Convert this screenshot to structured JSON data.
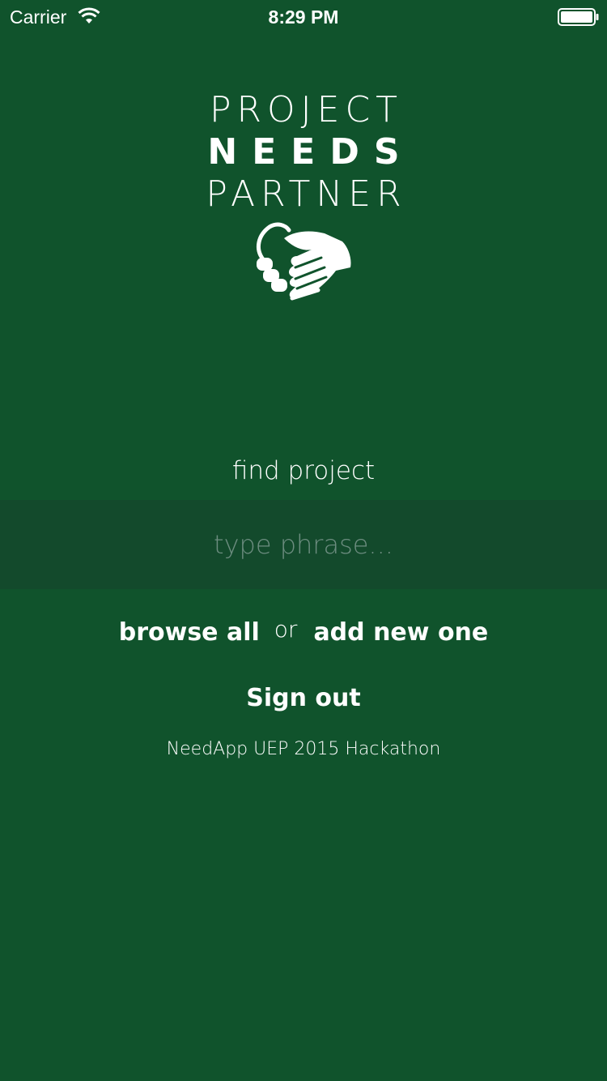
{
  "status_bar": {
    "carrier": "Carrier",
    "time": "8:29 PM",
    "wifi_icon": "wifi-icon",
    "battery_icon": "battery-full-icon"
  },
  "logo": {
    "line1": "PROJECT",
    "line2": "NEEDS",
    "line3": "PARTNER",
    "icon": "handshake-icon"
  },
  "search": {
    "label": "find project",
    "placeholder": "type phrase..."
  },
  "actions": {
    "browse_all": "browse all",
    "or": "or",
    "add_new": "add new one",
    "sign_out": "Sign out"
  },
  "footer": {
    "text": "NeedApp UEP 2015 Hackathon"
  },
  "colors": {
    "background": "#10532c",
    "search_band": "#134a2c",
    "placeholder": "#6d8d80",
    "text": "#ffffff"
  }
}
